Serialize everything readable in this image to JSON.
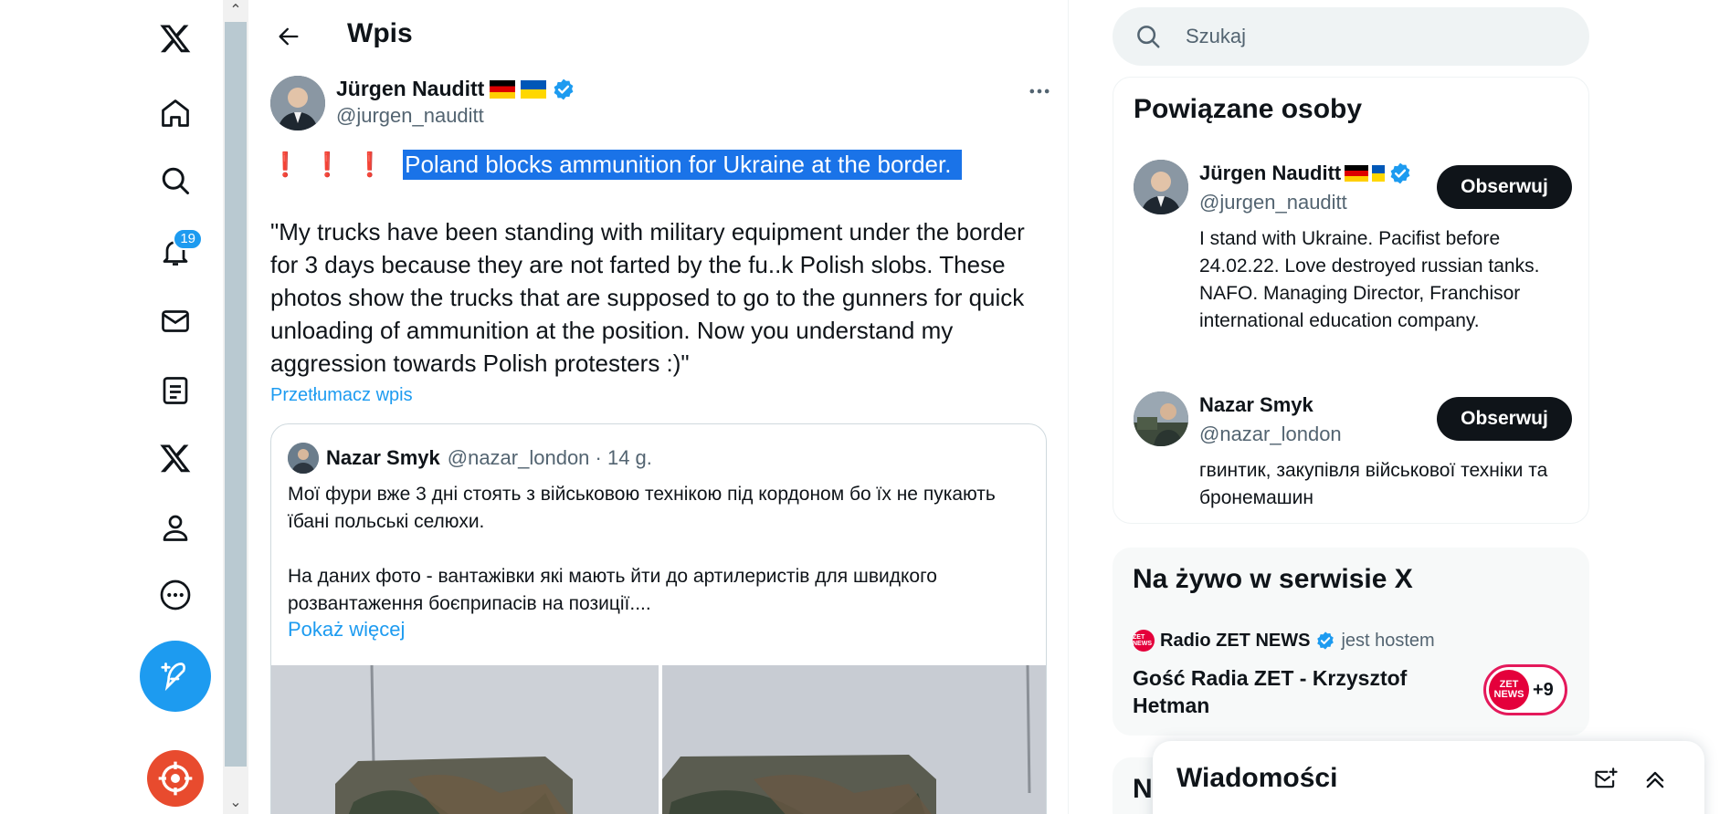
{
  "nav": {
    "notifications_badge": "19",
    "items": [
      "X",
      "Strona główna",
      "Eksploruj",
      "Powiadomienia",
      "Wiadomości",
      "Listy",
      "Premium",
      "Profil",
      "Więcej"
    ]
  },
  "header": {
    "title": "Wpis"
  },
  "tweet": {
    "author_name": "Jürgen Nauditt",
    "author_handle": "@jurgen_nauditt",
    "exclaims": "❗❗❗",
    "highlighted_text": "Poland blocks ammunition for Ukraine at the border.",
    "body": "\"My trucks have been standing with military equipment under the border for 3 days because they are not farted by the fu..k Polish slobs. These photos show the trucks that are supposed to go to the gunners for quick unloading of ammunition at the position. Now you understand my aggression towards Polish protesters :)\"",
    "translate_label": "Przetłumacz wpis"
  },
  "quote": {
    "name": "Nazar Smyk",
    "meta": "@nazar_london · 14 g.",
    "body": "Мої фури вже 3 дні стоять з військовою технікою під кордоном бо  їх не пукають їбані польські селюхи.\n\nНа даних фото - вантажівки які мають йти до артилеристів для швидкого розвантаження боєприпасів на позиції....",
    "show_more": "Pokaż więcej"
  },
  "search": {
    "placeholder": "Szukaj"
  },
  "related": {
    "title": "Powiązane osoby",
    "people": [
      {
        "name": "Jürgen Nauditt",
        "handle": "@jurgen_nauditt",
        "bio": "I stand with Ukraine. Pacifist before 24.02.22. Love destroyed russian tanks. NAFO. Managing Director, Franchisor international education company.",
        "follow_label": "Obserwuj"
      },
      {
        "name": "Nazar Smyk",
        "handle": "@nazar_london",
        "bio": "гвинтик, закупівля військової техніки та бронемашин",
        "follow_label": "Obserwuj"
      }
    ]
  },
  "live": {
    "title": "Na żywo w serwisie X",
    "host_logo": "ZET NEWS",
    "host_name": "Radio ZET NEWS",
    "host_role": "jest hostem",
    "space_title": "Gość Radia ZET - Krzysztof Hetman",
    "listener_count": "+9"
  },
  "third_panel": {
    "title_partial": "N"
  },
  "messages": {
    "title": "Wiadomości"
  },
  "colors": {
    "accent": "#1d9bf0",
    "text": "#0f1419",
    "secondary": "#536471",
    "selection": "#1a73e8"
  }
}
